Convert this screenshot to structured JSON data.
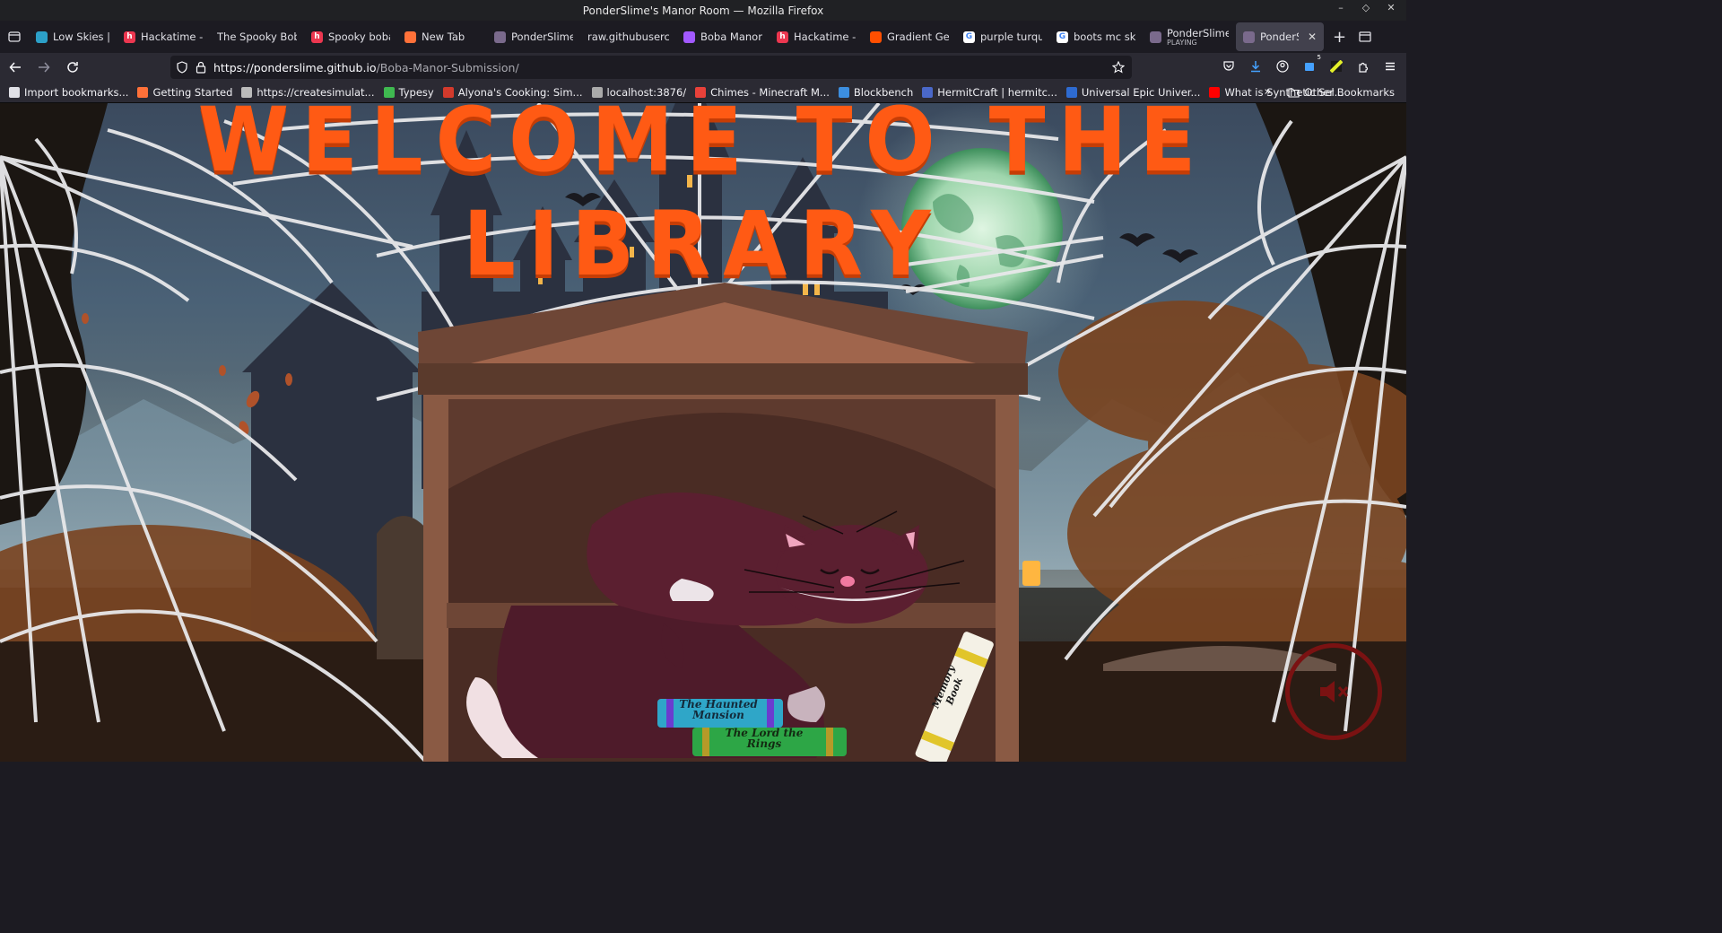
{
  "window": {
    "title": "PonderSlime's Manor Room — Mozilla Firefox"
  },
  "tabs": [
    {
      "label": "Low Skies | Ha",
      "favicon": "tab-favicon",
      "color": "#2ca0c8",
      "glyph": ""
    },
    {
      "label": "Hackatime - C",
      "favicon": "hackatime-favicon",
      "color": "#ec3750",
      "glyph": "h"
    },
    {
      "label": "The Spooky Boba",
      "favicon": "",
      "color": "",
      "glyph": ""
    },
    {
      "label": "Spooky boba s",
      "favicon": "hackatime-favicon",
      "color": "#ec3750",
      "glyph": "h"
    },
    {
      "label": "New Tab",
      "favicon": "firefox-favicon",
      "color": "#ff7139",
      "glyph": ""
    },
    {
      "label": "PonderSlime's",
      "favicon": "manor-favicon",
      "color": "#7a6a8c",
      "glyph": ""
    },
    {
      "label": "raw.githubuserco",
      "favicon": "",
      "color": "",
      "glyph": ""
    },
    {
      "label": "Boba Manor D",
      "favicon": "figma-favicon",
      "color": "#a259ff",
      "glyph": ""
    },
    {
      "label": "Hackatime - C",
      "favicon": "hackatime-favicon",
      "color": "#ec3750",
      "glyph": "h"
    },
    {
      "label": "Gradient Gene",
      "favicon": "gradient-favicon",
      "color": "#ff4f00",
      "glyph": ""
    },
    {
      "label": "purple turquo",
      "favicon": "google-favicon",
      "color": "#ffffff",
      "glyph": "G"
    },
    {
      "label": "boots mc skin",
      "favicon": "google-favicon",
      "color": "#ffffff",
      "glyph": "G"
    },
    {
      "label": "PonderSlime's",
      "sub": "PLAYING",
      "favicon": "manor-favicon",
      "color": "#7a6a8c",
      "glyph": ""
    },
    {
      "label": "PonderSlim",
      "favicon": "manor-favicon",
      "color": "#7a6a8c",
      "glyph": "",
      "active": true
    }
  ],
  "url": {
    "host": "https://ponderslime.github.io",
    "path": "/Boba-Manor-Submission/"
  },
  "toolbar": {
    "extensions_badge": "5"
  },
  "bookmarks": [
    {
      "label": "Import bookmarks...",
      "color": "#e0e0e6"
    },
    {
      "label": "Getting Started",
      "color": "#ff7139"
    },
    {
      "label": "https://createsimulat...",
      "color": "#bbbbbb"
    },
    {
      "label": "Typesy",
      "color": "#3fb950"
    },
    {
      "label": "Alyona's Cooking: Sim...",
      "color": "#d33a2c"
    },
    {
      "label": "localhost:3876/",
      "color": "#aaaaaa"
    },
    {
      "label": "Chimes - Minecraft M...",
      "color": "#e8413a"
    },
    {
      "label": "Blockbench",
      "color": "#3c8ee0"
    },
    {
      "label": "HermitCraft | hermitc...",
      "color": "#4a68c9"
    },
    {
      "label": "Universal Epic Univer...",
      "color": "#2e6bd1"
    },
    {
      "label": "What is Synthetic Sel...",
      "color": "#ff0000"
    }
  ],
  "bookmarks_other": "Other Bookmarks",
  "page": {
    "heading": "WELCOME TO THE LIBRARY",
    "books": [
      "The Haunted Mansion",
      "The Lord the Rings",
      "Memory Book"
    ],
    "colors": {
      "heading": "#ff5a14",
      "shelf": "#8a5a44",
      "cat": "#5b1f30",
      "moon": "#bfe6c9"
    },
    "sound": "muted"
  }
}
